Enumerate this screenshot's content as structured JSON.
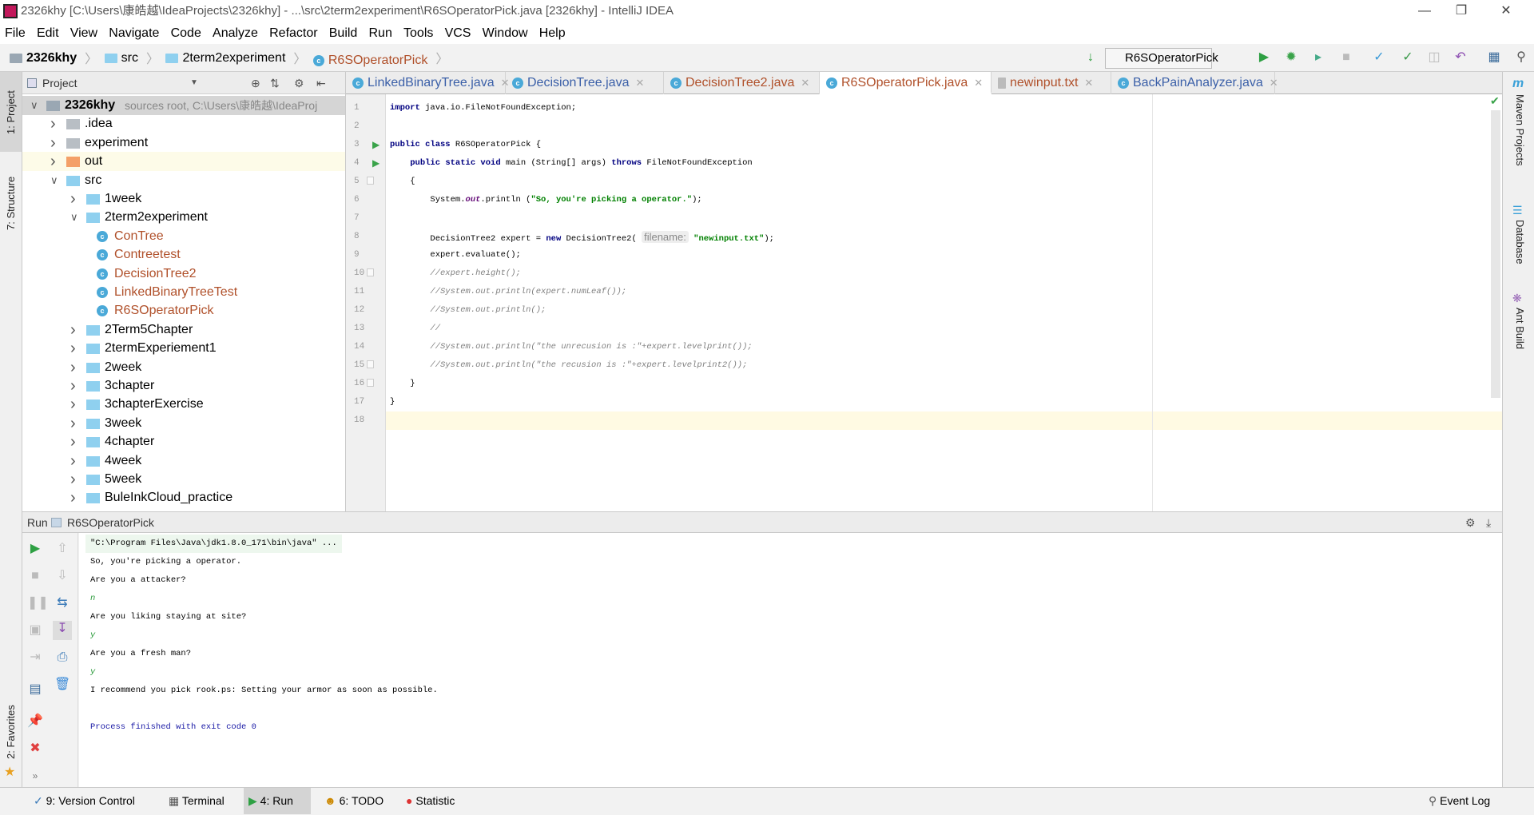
{
  "window": {
    "title": "2326khy [C:\\Users\\康皓越\\IdeaProjects\\2326khy] - ...\\src\\2term2experiment\\R6SOperatorPick.java [2326khy] - IntelliJ IDEA"
  },
  "menu": [
    "File",
    "Edit",
    "View",
    "Navigate",
    "Code",
    "Analyze",
    "Refactor",
    "Build",
    "Run",
    "Tools",
    "VCS",
    "Window",
    "Help"
  ],
  "breadcrumb": [
    "2326khy",
    "src",
    "2term2experiment",
    "R6SOperatorPick"
  ],
  "toolbar": {
    "run_config": "R6SOperatorPick"
  },
  "left_stripe": {
    "project": "1: Project",
    "structure": "7: Structure",
    "favorites": "2: Favorites"
  },
  "right_stripe": {
    "maven": "Maven Projects",
    "database": "Database",
    "ant": "Ant Build"
  },
  "project_panel": {
    "title": "Project",
    "tree": [
      {
        "depth": 0,
        "label": "2326khy",
        "suffix": "sources root, C:\\Users\\康皓越\\IdeaProj",
        "type": "module",
        "expanded": true
      },
      {
        "depth": 1,
        "label": ".idea",
        "type": "folder-gray",
        "expanded": false
      },
      {
        "depth": 1,
        "label": "experiment",
        "type": "folder-gray",
        "expanded": false
      },
      {
        "depth": 1,
        "label": "out",
        "type": "folder-orange",
        "expanded": false
      },
      {
        "depth": 1,
        "label": "src",
        "type": "folder",
        "expanded": true
      },
      {
        "depth": 2,
        "label": "1week",
        "type": "folder",
        "expanded": false
      },
      {
        "depth": 2,
        "label": "2term2experiment",
        "type": "folder",
        "expanded": true
      },
      {
        "depth": 3,
        "label": "ConTree",
        "type": "class"
      },
      {
        "depth": 3,
        "label": "Contreetest",
        "type": "class-main"
      },
      {
        "depth": 3,
        "label": "DecisionTree2",
        "type": "class"
      },
      {
        "depth": 3,
        "label": "LinkedBinaryTreeTest",
        "type": "class-main"
      },
      {
        "depth": 3,
        "label": "R6SOperatorPick",
        "type": "class-main"
      },
      {
        "depth": 2,
        "label": "2Term5Chapter",
        "type": "folder",
        "expanded": false
      },
      {
        "depth": 2,
        "label": "2termExperiement1",
        "type": "folder",
        "expanded": false
      },
      {
        "depth": 2,
        "label": "2week",
        "type": "folder",
        "expanded": false
      },
      {
        "depth": 2,
        "label": "3chapter",
        "type": "folder",
        "expanded": false
      },
      {
        "depth": 2,
        "label": "3chapterExercise",
        "type": "folder",
        "expanded": false
      },
      {
        "depth": 2,
        "label": "3week",
        "type": "folder",
        "expanded": false
      },
      {
        "depth": 2,
        "label": "4chapter",
        "type": "folder",
        "expanded": false
      },
      {
        "depth": 2,
        "label": "4week",
        "type": "folder",
        "expanded": false
      },
      {
        "depth": 2,
        "label": "5week",
        "type": "folder",
        "expanded": false
      },
      {
        "depth": 2,
        "label": "BuleInkCloud_practice",
        "type": "folder",
        "expanded": false
      }
    ]
  },
  "tabs": [
    {
      "label": "LinkedBinaryTree.java",
      "color": "#3a5fa8",
      "icon": "class"
    },
    {
      "label": "DecisionTree.java",
      "color": "#3a5fa8",
      "icon": "class"
    },
    {
      "label": "DecisionTree2.java",
      "color": "#b0502a",
      "icon": "class"
    },
    {
      "label": "R6SOperatorPick.java",
      "color": "#b0502a",
      "icon": "class",
      "active": true
    },
    {
      "label": "newinput.txt",
      "color": "#b0502a",
      "icon": "text"
    },
    {
      "label": "BackPainAnalyzer.java",
      "color": "#3a5fa8",
      "icon": "class"
    }
  ],
  "editor": {
    "lines": [
      [
        {
          "t": "import",
          "c": "kw"
        },
        {
          "t": " java.io.FileNotFoundException;"
        }
      ],
      [],
      [
        {
          "t": "public class",
          "c": "kw"
        },
        {
          "t": " R6SOperatorPick {"
        }
      ],
      [
        {
          "t": "    "
        },
        {
          "t": "public static void",
          "c": "kw"
        },
        {
          "t": " main (String[] args) "
        },
        {
          "t": "throws",
          "c": "kw"
        },
        {
          "t": " FileNotFoundException"
        }
      ],
      [
        {
          "t": "    {"
        }
      ],
      [
        {
          "t": "        System."
        },
        {
          "t": "out",
          "c": "st"
        },
        {
          "t": ".println ("
        },
        {
          "t": "\"So, you're picking a operator.\"",
          "c": "str"
        },
        {
          "t": ");"
        }
      ],
      [],
      [
        {
          "t": "        DecisionTree2 expert = "
        },
        {
          "t": "new",
          "c": "kw"
        },
        {
          "t": " DecisionTree2( "
        },
        {
          "t": "filename:",
          "c": "hint"
        },
        {
          "t": " "
        },
        {
          "t": "\"newinput.txt\"",
          "c": "str"
        },
        {
          "t": ");"
        }
      ],
      [
        {
          "t": "        expert.evaluate();"
        }
      ],
      [
        {
          "t": "        //expert.height();",
          "c": "cm"
        }
      ],
      [
        {
          "t": "        //System.out.println(expert.numLeaf());",
          "c": "cm"
        }
      ],
      [
        {
          "t": "        //System.out.println();",
          "c": "cm"
        }
      ],
      [
        {
          "t": "        //",
          "c": "cm"
        }
      ],
      [
        {
          "t": "        //System.out.println(\"the unrecusion is :\"+expert.levelprint());",
          "c": "cm"
        }
      ],
      [
        {
          "t": "        //System.out.println(\"the recusion is :\"+expert.levelprint2());",
          "c": "cm"
        }
      ],
      [
        {
          "t": "    }"
        }
      ],
      [
        {
          "t": "}"
        }
      ],
      []
    ],
    "current_line": 18,
    "run_gutter_lines": [
      3,
      4
    ]
  },
  "run": {
    "label": "Run",
    "config": "R6SOperatorPick",
    "output": [
      {
        "t": "\"C:\\Program Files\\Java\\jdk1.8.0_171\\bin\\java\" ...",
        "c": "cmd"
      },
      {
        "t": "So, you're picking a operator."
      },
      {
        "t": "Are you a attacker?"
      },
      {
        "t": "n",
        "c": "input"
      },
      {
        "t": "Are you liking staying at site?"
      },
      {
        "t": "y",
        "c": "input"
      },
      {
        "t": "Are you a fresh man?"
      },
      {
        "t": "y",
        "c": "input"
      },
      {
        "t": "I recommend you pick rook.ps: Setting your armor as soon as possible."
      },
      {
        "t": ""
      },
      {
        "t": "Process finished with exit code 0",
        "c": "exit"
      }
    ]
  },
  "statusbar": {
    "version_control": "9: Version Control",
    "terminal": "Terminal",
    "run": "4: Run",
    "todo": "6: TODO",
    "statistic": "Statistic",
    "event_log": "Event Log"
  }
}
